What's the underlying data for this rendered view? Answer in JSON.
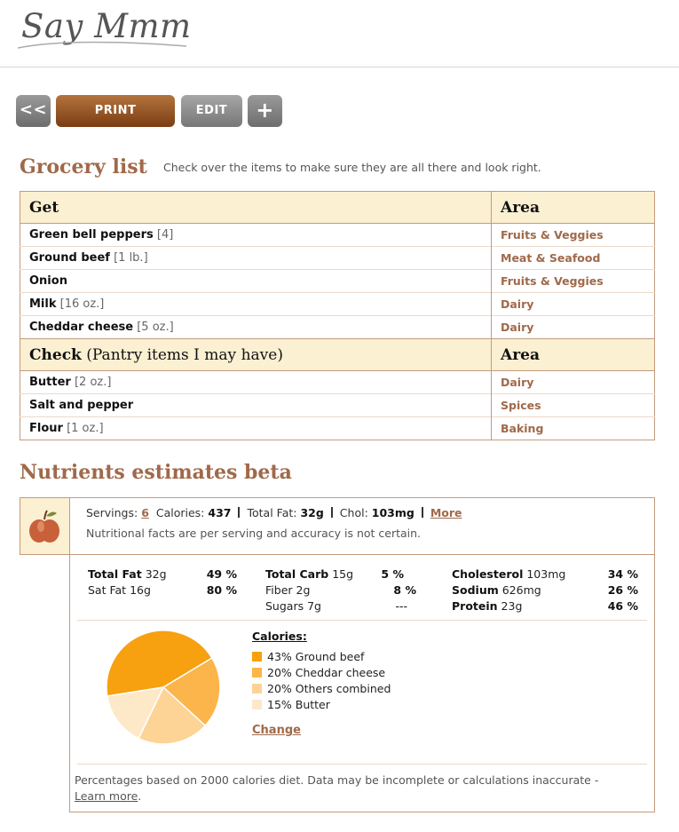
{
  "header": {
    "logo_text": "Say Mmm"
  },
  "toolbar": {
    "back_label": "<<",
    "print_label": "PRINT",
    "edit_label": "EDIT",
    "add_label": "+"
  },
  "grocery": {
    "title": "Grocery list",
    "subtitle": "Check over the items to make sure they are all there and look right.",
    "get_header": "Get",
    "area_header": "Area",
    "get_items": [
      {
        "name": "Green bell peppers",
        "qty": "[4]",
        "area": "Fruits & Veggies"
      },
      {
        "name": "Ground beef",
        "qty": "[1 lb.]",
        "area": "Meat & Seafood"
      },
      {
        "name": "Onion",
        "qty": "",
        "area": "Fruits & Veggies"
      },
      {
        "name": "Milk",
        "qty": "[16 oz.]",
        "area": "Dairy"
      },
      {
        "name": "Cheddar cheese",
        "qty": "[5 oz.]",
        "area": "Dairy"
      }
    ],
    "check_header": "Check",
    "check_header_sub": "(Pantry items I may have)",
    "check_area_header": "Area",
    "check_items": [
      {
        "name": "Butter",
        "qty": "[2 oz.]",
        "area": "Dairy"
      },
      {
        "name": "Salt and pepper",
        "qty": "",
        "area": "Spices"
      },
      {
        "name": "Flour",
        "qty": "[1 oz.]",
        "area": "Baking"
      }
    ]
  },
  "nutrients": {
    "title": "Nutrients estimates beta",
    "servings_label": "Servings:",
    "servings_value": "6",
    "calories_label": "Calories:",
    "calories_value": "437",
    "fat_label": "Total Fat:",
    "fat_value": "32g",
    "chol_label": "Chol:",
    "chol_value": "103mg",
    "more_label": "More",
    "disclaimer": "Nutritional facts are per serving and accuracy is not certain.",
    "col1": [
      {
        "label": "Total Fat",
        "amount": "32g",
        "pct": "49 %",
        "bold": true
      },
      {
        "label": "Sat Fat",
        "amount": "16g",
        "pct": "80 %",
        "bold": false
      }
    ],
    "col2": [
      {
        "label": "Total Carb",
        "amount": "15g",
        "pct": "5 %",
        "bold": true
      },
      {
        "label": "Fiber",
        "amount": "2g",
        "pct": "8 %",
        "bold": false
      },
      {
        "label": "Sugars",
        "amount": "7g",
        "pct": "---",
        "bold": false
      }
    ],
    "col3": [
      {
        "label": "Cholesterol",
        "amount": "103mg",
        "pct": "34 %",
        "bold": true
      },
      {
        "label": "Sodium",
        "amount": "626mg",
        "pct": "26 %",
        "bold": true
      },
      {
        "label": "Protein",
        "amount": "23g",
        "pct": "46 %",
        "bold": true
      }
    ],
    "calories_title": "Calories:",
    "change_label": "Change",
    "footnote_text": "Percentages based on 2000 calories diet. Data may be incomplete or calculations inaccurate -",
    "learn_more": "Learn more",
    "footnote_end": "."
  },
  "chart_data": {
    "type": "pie",
    "title": "Calories:",
    "slices": [
      {
        "label": "43% Ground beef",
        "value": 43,
        "color": "#f7a010"
      },
      {
        "label": "20% Cheddar cheese",
        "value": 20,
        "color": "#fbb54a"
      },
      {
        "label": "20% Others combined",
        "value": 20,
        "color": "#fdd396"
      },
      {
        "label": "15% Butter",
        "value": 15,
        "color": "#fde8c8"
      }
    ]
  },
  "colors": {
    "accent": "#a0694a",
    "header_bg": "#fbf0d2",
    "border": "#c49a7e"
  }
}
